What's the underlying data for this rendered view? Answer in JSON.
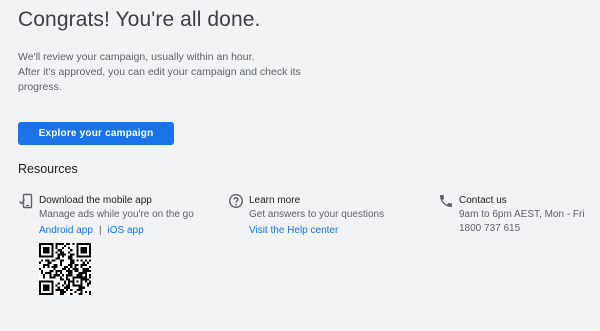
{
  "header": {
    "title": "Congrats! You're all done."
  },
  "description": {
    "line1": "We'll review your campaign, usually within an hour.",
    "line2": "After it's approved, you can edit your campaign and check its",
    "line3": "progress."
  },
  "actions": {
    "explore_label": "Explore your campaign"
  },
  "resources": {
    "heading": "Resources",
    "mobile": {
      "icon": "mobile-phone-icon",
      "title": "Download the mobile app",
      "subtitle": "Manage ads while you're on the go",
      "android_label": "Android app",
      "separator": "|",
      "ios_label": "iOS app",
      "qr_icon": "qr-code-icon"
    },
    "learn": {
      "icon": "help-circle-icon",
      "title": "Learn more",
      "subtitle": "Get answers to your questions",
      "link_label": "Visit the Help center"
    },
    "contact": {
      "icon": "phone-icon",
      "title": "Contact us",
      "hours": "9am to 6pm AEST, Mon - Fri",
      "phone": "1800 737 615"
    }
  },
  "colors": {
    "background": "#f1f3f4",
    "primary": "#1a73e8",
    "text_primary": "#202124",
    "text_secondary": "#5f6368"
  }
}
